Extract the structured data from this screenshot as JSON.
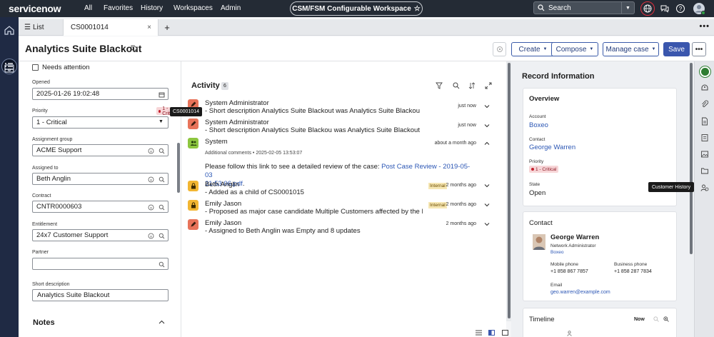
{
  "topnav": {
    "logo": "servicenow",
    "links": [
      "All",
      "Favorites",
      "History",
      "Workspaces",
      "Admin"
    ],
    "workspace": "CSM/FSM Configurable Workspace",
    "search_placeholder": "Search"
  },
  "tabs": {
    "list": "List",
    "case": "CS0001014",
    "close": "×",
    "add": "+",
    "more": "•••"
  },
  "record": {
    "title": "Analytics Suite Blackout"
  },
  "header_buttons": {
    "create": "Create",
    "compose": "Compose",
    "manage": "Manage case",
    "save": "Save",
    "more": "•••"
  },
  "form": {
    "needs_attention": "Needs attention",
    "opened_label": "Opened",
    "opened_value": "2025-01-26 19:02:48",
    "priority_label": "Priority",
    "priority_value": "1 - Critical",
    "priority_badge": "1 - Criti...",
    "assignment_group_label": "Assignment group",
    "assignment_group_value": "ACME Support",
    "assigned_to_label": "Assigned to",
    "assigned_to_value": "Beth Anglin",
    "contract_label": "Contract",
    "contract_value": "CNTR0000603",
    "entitlement_label": "Entitlement",
    "entitlement_value": "24x7 Customer Support",
    "partner_label": "Partner",
    "partner_value": "",
    "short_desc_label": "Short description",
    "short_desc_value": "Analytics Suite Blackout",
    "notes": "Notes"
  },
  "tooltips": {
    "case": "CS0001014",
    "customer_history": "Customer History"
  },
  "activity": {
    "title": "Activity",
    "count": "6",
    "entries": [
      {
        "name": "System Administrator",
        "text": "- Short description Analytics Suite Blackout was Analytics Suite Blackou",
        "time": "just now",
        "avatar_color": "#e8735a"
      },
      {
        "name": "System Administrator",
        "text": "- Short description Analytics Suite Blackou was Analytics Suite Blackout",
        "time": "just now",
        "avatar_color": "#e8735a"
      },
      {
        "name": "System",
        "sub": "Additional comments  •  2025-02-05 13:53:07",
        "time": "about a month ago",
        "comment_pre": "Please follow this link to see a detailed review of the case: ",
        "comment_link1": "Post Case Review - 2019-05-03",
        "comment_link2": "21:53:06.pdf",
        "comment_post": ".",
        "avatar_color": "#8dc63f"
      },
      {
        "name": "Beth Anglin",
        "text": "- Added as a child of CS0001015",
        "time": "2 months ago",
        "internal": "Internal",
        "avatar_color": "#f2b632"
      },
      {
        "name": "Emily Jason",
        "text": "- Proposed as major case candidate Multiple Customers affected by the Bl...",
        "time": "2 months ago",
        "internal": "Internal",
        "avatar_color": "#f2b632"
      },
      {
        "name": "Emily Jason",
        "text": "- Assigned to Beth Anglin was Empty and 8 updates",
        "time": "2 months ago",
        "avatar_color": "#e8735a"
      }
    ]
  },
  "record_info": {
    "title": "Record Information",
    "overview": {
      "head": "Overview",
      "account_label": "Account",
      "account": "Boxeo",
      "contact_label": "Contact",
      "contact": "George Warren",
      "priority_label": "Priority",
      "priority": "1 - Critical",
      "state_label": "State",
      "state": "Open"
    },
    "contact": {
      "head": "Contact",
      "name": "George Warren",
      "role": "Network Administrator",
      "company": "Boxeo",
      "mobile_label": "Mobile phone",
      "mobile": "+1 858 867 7857",
      "business_label": "Business phone",
      "business": "+1 858 287 7834",
      "email_label": "Email",
      "email": "geo.warren@example.com"
    },
    "timeline": {
      "head": "Timeline",
      "now": "Now"
    }
  },
  "colors": {
    "topnav": "#242b35",
    "accent": "#3a56ad",
    "link": "#2c57b5",
    "critical": "#c4202e",
    "internal": "#f6e7b4",
    "leftrail": "#1f2a44"
  }
}
